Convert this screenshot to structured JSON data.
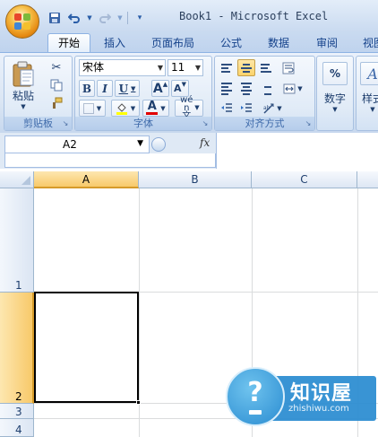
{
  "window": {
    "title": "Book1 - Microsoft Excel"
  },
  "qat": {
    "save_icon": "save-icon",
    "undo_icon": "undo-icon",
    "redo_icon": "redo-icon",
    "customize_icon": "customize-qat-icon"
  },
  "tabs": [
    {
      "label": "开始",
      "active": true
    },
    {
      "label": "插入"
    },
    {
      "label": "页面布局"
    },
    {
      "label": "公式"
    },
    {
      "label": "数据"
    },
    {
      "label": "审阅"
    },
    {
      "label": "视图"
    }
  ],
  "ribbon": {
    "clipboard": {
      "group_label": "剪贴板",
      "paste_label": "粘贴"
    },
    "font": {
      "group_label": "字体",
      "font_name": "宋体",
      "font_size": "11",
      "bold": "B",
      "italic": "I",
      "underline": "U",
      "grow": "A",
      "shrink": "A",
      "font_color_letter": "A",
      "phonetic": "wén 文"
    },
    "alignment": {
      "group_label": "对齐方式"
    },
    "number": {
      "label": "数字",
      "percent": "%"
    },
    "styles": {
      "label": "样式",
      "letter": "A"
    }
  },
  "formula_bar": {
    "name_box": "A2",
    "fx": "fx",
    "content": ""
  },
  "sheet": {
    "columns": [
      "A",
      "B",
      "C"
    ],
    "rows": [
      "1",
      "2",
      "3",
      "4"
    ],
    "selected_cell": "A2"
  },
  "colors": {
    "accent": "#15428b",
    "selection": "#f8c96a"
  },
  "watermark": {
    "title": "知识屋",
    "subtitle": "zhishiwu.com"
  }
}
